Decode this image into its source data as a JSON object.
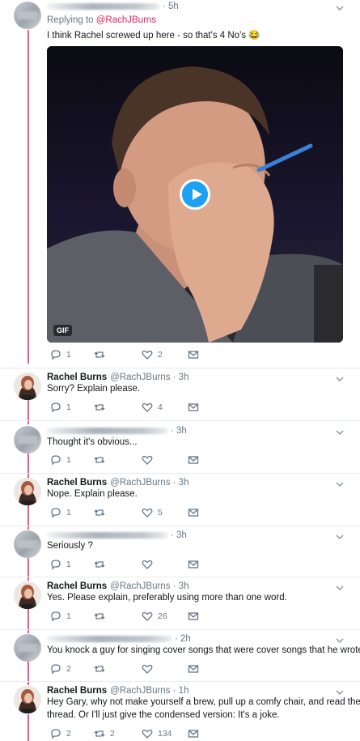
{
  "colors": {
    "accent": "#e0245e",
    "muted": "#657786",
    "link_blue": "#1da1f2"
  },
  "tweets": [
    {
      "id": "t1",
      "author_blurred": true,
      "time": "· 5h",
      "replying_prefix": "Replying to ",
      "replying_handle": "@RachJBurns",
      "text": "I think Rachel screwed up here - so that's 4 No's 😂",
      "media": {
        "badge": "GIF",
        "play_icon": "play-icon"
      },
      "replies": "1",
      "retweets": "",
      "likes": "2"
    },
    {
      "id": "t2",
      "author_blurred": false,
      "name": "Rachel Burns",
      "handle": "@RachJBurns",
      "time": "· 3h",
      "text": "Sorry? Explain please.",
      "replies": "1",
      "retweets": "",
      "likes": "4"
    },
    {
      "id": "t3",
      "author_blurred": true,
      "time": "· 3h",
      "text": "Thought it's obvious...",
      "replies": "1",
      "retweets": "",
      "likes": ""
    },
    {
      "id": "t4",
      "author_blurred": false,
      "name": "Rachel Burns",
      "handle": "@RachJBurns",
      "time": "· 3h",
      "text": "Nope. Explain please.",
      "replies": "1",
      "retweets": "",
      "likes": "5"
    },
    {
      "id": "t5",
      "author_blurred": true,
      "time": "· 3h",
      "text": "Seriously ?",
      "replies": "1",
      "retweets": "",
      "likes": ""
    },
    {
      "id": "t6",
      "author_blurred": false,
      "name": "Rachel Burns",
      "handle": "@RachJBurns",
      "time": "· 3h",
      "text": "Yes. Please explain, preferably using more than one word.",
      "replies": "1",
      "retweets": "",
      "likes": "26"
    },
    {
      "id": "t7",
      "author_blurred": true,
      "time": "· 2h",
      "text": "You knock a guy for singing cover songs that were cover songs that he wrote...",
      "replies": "2",
      "retweets": "",
      "likes": ""
    },
    {
      "id": "t8",
      "author_blurred": false,
      "name": "Rachel Burns",
      "handle": "@RachJBurns",
      "time": "· 1h",
      "text_line1": "Hey Gary, why not make yourself a brew, pull up a comfy chair, and read the",
      "text_line2": "thread. Or I'll just give the condensed version: It's a joke.",
      "replies": "2",
      "retweets": "2",
      "likes": "134"
    }
  ],
  "icons": {
    "reply": "reply-icon",
    "retweet": "retweet-icon",
    "like": "heart-icon",
    "dm": "envelope-icon",
    "chevron": "chevron-down-icon"
  }
}
